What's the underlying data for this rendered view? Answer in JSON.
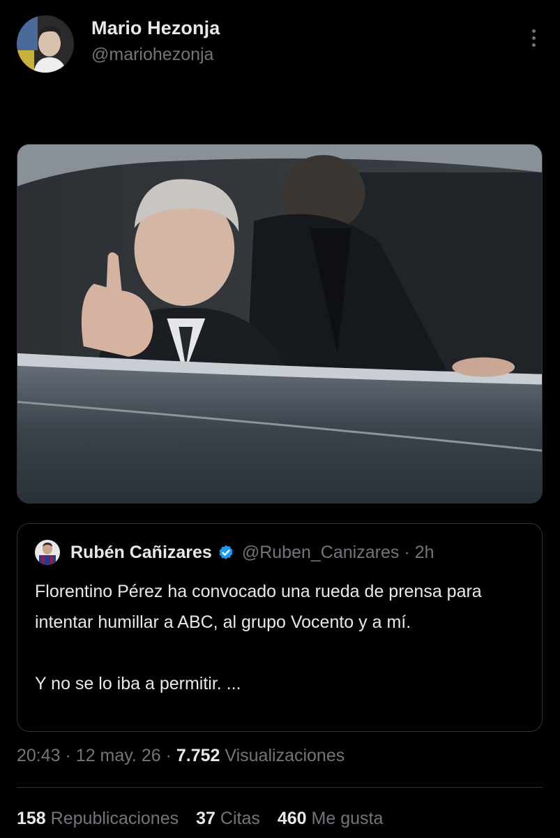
{
  "author": {
    "name": "Mario Hezonja",
    "handle": "@mariohezonja"
  },
  "icons": {
    "more": "more-horizontal-icon",
    "verified": "verified-badge-icon",
    "verified_color": "#1d9bf0"
  },
  "quoted_tweet": {
    "name": "Rubén Cañizares",
    "handle": "@Ruben_Canizares",
    "separator": "·",
    "time": "2h",
    "text_lines": [
      "Florentino Pérez ha convocado una rueda de prensa para intentar humillar a ABC, al grupo Vocento y a mí.",
      "Y no se lo iba a permitir. ..."
    ]
  },
  "meta": {
    "time": "20:43",
    "sep1": "·",
    "date": "12 may. 26",
    "sep2": "·",
    "views_count": "7.752",
    "views_label": "Visualizaciones"
  },
  "stats": {
    "reposts_count": "158",
    "reposts_label": "Republicaciones",
    "quotes_count": "37",
    "quotes_label": "Citas",
    "likes_count": "460",
    "likes_label": "Me gusta"
  },
  "colors": {
    "background": "#000000",
    "primary_text": "#e7e9ea",
    "secondary_text": "#71767b",
    "border": "#2f3336"
  }
}
